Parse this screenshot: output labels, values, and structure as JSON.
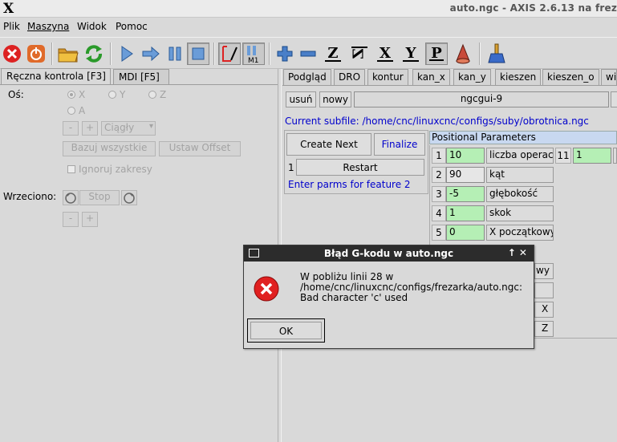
{
  "window": {
    "logo": "X",
    "title": "auto.ngc - AXIS 2.6.13 na frez"
  },
  "menu": [
    "Plik",
    "Maszyna",
    "Widok",
    "Pomoc"
  ],
  "toolbar": {
    "letters": [
      "Z",
      "Z",
      "X",
      "Y",
      "P"
    ],
    "m1_label": "M1"
  },
  "left": {
    "tabs": [
      "Ręczna kontrola [F3]",
      "MDI [F5]"
    ],
    "axis_label": "Oś:",
    "axes": [
      "X",
      "Y",
      "Z",
      "A"
    ],
    "jog_minus": "-",
    "jog_plus": "+",
    "jog_mode": "Ciągły",
    "home_all": "Bazuj wszystkie",
    "touch_off": "Ustaw Offset",
    "ignore_limits": "Ignoruj zakresy",
    "spindle_label": "Wrzeciono:",
    "spindle_stop": "Stop",
    "spindle_minus": "-",
    "spindle_plus": "+"
  },
  "right": {
    "tabs": [
      "Podgląd",
      "DRO",
      "kontur",
      "kan_x",
      "kan_y",
      "kieszen",
      "kieszen_o",
      "wi"
    ],
    "remove": "usuń",
    "new": "nowy",
    "file_name": "ngcgui-9",
    "current_subfile": "Current subfile: /home/cnc/linuxcnc/configs/suby/obrotnica.ngc",
    "create_next": "Create Next",
    "finalize": "Finalize",
    "restart_num": "1",
    "restart": "Restart",
    "enter_parms": "Enter parms for feature 2",
    "params_header": "Positional Parameters",
    "params": [
      {
        "num": "1",
        "value": "10",
        "label": "liczba operacji"
      },
      {
        "num": "2",
        "value": "90",
        "label": "kąt"
      },
      {
        "num": "3",
        "value": "-5",
        "label": "głębokość"
      },
      {
        "num": "4",
        "value": "1",
        "label": "skok"
      },
      {
        "num": "5",
        "value": "0",
        "label": "X początkowy"
      }
    ],
    "param11": {
      "num": "11",
      "value": "1"
    },
    "hidden_label_frags": [
      "wy",
      "X",
      "Z"
    ]
  },
  "dialog": {
    "title": "Błąd G-kodu w auto.ngc",
    "controls": "↑ ✕",
    "message_line1": "W pobliżu linii 28 w",
    "message_line2": "/home/cnc/linuxcnc/configs/frezarka/auto.ngc:",
    "message_line3": "Bad character 'c' used",
    "ok": "OK"
  },
  "colors": {
    "accent_blue": "#0000cc",
    "param_green": "#b5efb5",
    "dialog_title_bg": "#2c2c2c",
    "error_red": "#e02020"
  }
}
